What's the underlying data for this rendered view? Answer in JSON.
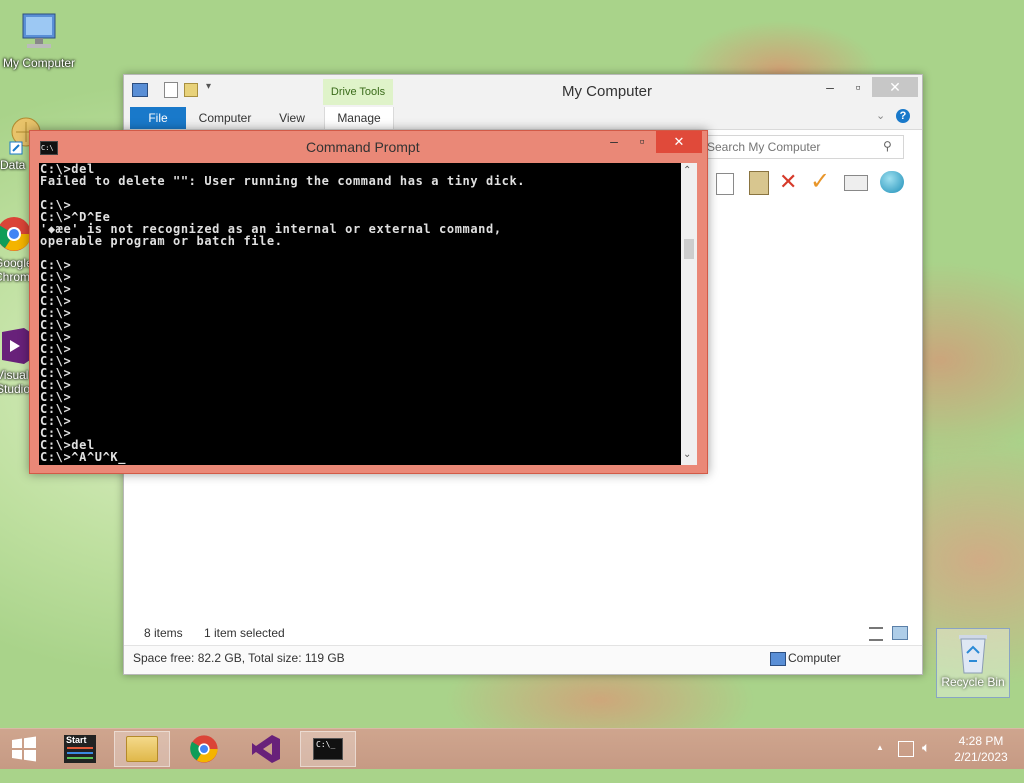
{
  "desktop": {
    "icons": [
      {
        "label": "My Computer"
      },
      {
        "label": "Data"
      },
      {
        "label": "Google Chrome"
      },
      {
        "label": "Visual Studio"
      },
      {
        "label": "Recycle Bin"
      }
    ]
  },
  "explorer": {
    "title": "My Computer",
    "context_tab": "Drive Tools",
    "tabs": [
      "File",
      "Computer",
      "View",
      "Manage"
    ],
    "search_placeholder": "Search My Computer",
    "status_items": "8 items",
    "status_selected": "1 item selected",
    "details_space": "Space free: 82.2 GB, Total size: 119 GB",
    "details_location": "Computer"
  },
  "cmd": {
    "title": "Command Prompt",
    "lines": [
      "C:\\>del",
      "Failed to delete \"\": User running the command has a tiny dick.",
      "",
      "C:\\>",
      "C:\\>^D^Ee",
      "'◆æe' is not recognized as an internal or external command,",
      "operable program or batch file.",
      "",
      "C:\\>",
      "C:\\>",
      "C:\\>",
      "C:\\>",
      "C:\\>",
      "C:\\>",
      "C:\\>",
      "C:\\>",
      "C:\\>",
      "C:\\>",
      "C:\\>",
      "C:\\>",
      "C:\\>",
      "C:\\>",
      "C:\\>",
      "C:\\>del",
      "C:\\>^A^U^K_"
    ]
  },
  "taskbar": {
    "start_label": "Start",
    "time": "4:28 PM",
    "date": "2/21/2023"
  },
  "colors": {
    "accent_blue": "#1979ca",
    "cmd_frame": "#ea8877",
    "taskbar": "#c69a84"
  }
}
